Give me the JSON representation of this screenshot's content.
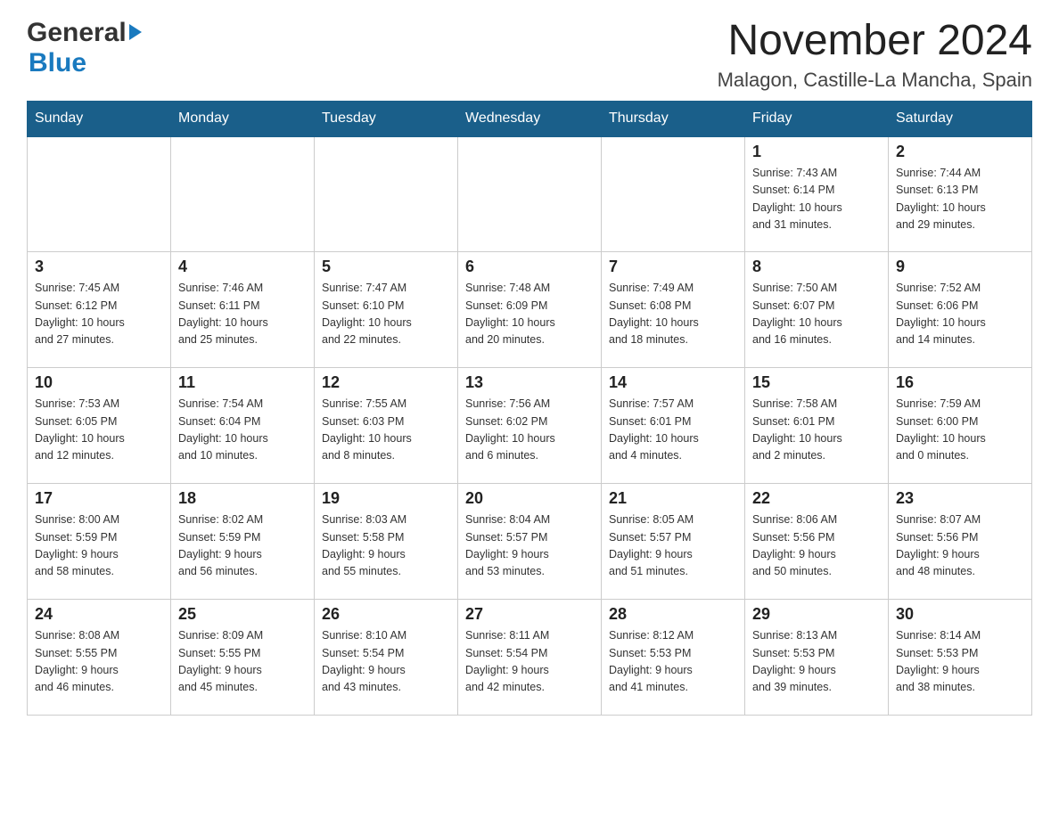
{
  "logo": {
    "general": "General",
    "blue": "Blue"
  },
  "title": {
    "month": "November 2024",
    "location": "Malagon, Castille-La Mancha, Spain"
  },
  "weekdays": [
    "Sunday",
    "Monday",
    "Tuesday",
    "Wednesday",
    "Thursday",
    "Friday",
    "Saturday"
  ],
  "weeks": [
    [
      {
        "day": "",
        "info": ""
      },
      {
        "day": "",
        "info": ""
      },
      {
        "day": "",
        "info": ""
      },
      {
        "day": "",
        "info": ""
      },
      {
        "day": "",
        "info": ""
      },
      {
        "day": "1",
        "info": "Sunrise: 7:43 AM\nSunset: 6:14 PM\nDaylight: 10 hours\nand 31 minutes."
      },
      {
        "day": "2",
        "info": "Sunrise: 7:44 AM\nSunset: 6:13 PM\nDaylight: 10 hours\nand 29 minutes."
      }
    ],
    [
      {
        "day": "3",
        "info": "Sunrise: 7:45 AM\nSunset: 6:12 PM\nDaylight: 10 hours\nand 27 minutes."
      },
      {
        "day": "4",
        "info": "Sunrise: 7:46 AM\nSunset: 6:11 PM\nDaylight: 10 hours\nand 25 minutes."
      },
      {
        "day": "5",
        "info": "Sunrise: 7:47 AM\nSunset: 6:10 PM\nDaylight: 10 hours\nand 22 minutes."
      },
      {
        "day": "6",
        "info": "Sunrise: 7:48 AM\nSunset: 6:09 PM\nDaylight: 10 hours\nand 20 minutes."
      },
      {
        "day": "7",
        "info": "Sunrise: 7:49 AM\nSunset: 6:08 PM\nDaylight: 10 hours\nand 18 minutes."
      },
      {
        "day": "8",
        "info": "Sunrise: 7:50 AM\nSunset: 6:07 PM\nDaylight: 10 hours\nand 16 minutes."
      },
      {
        "day": "9",
        "info": "Sunrise: 7:52 AM\nSunset: 6:06 PM\nDaylight: 10 hours\nand 14 minutes."
      }
    ],
    [
      {
        "day": "10",
        "info": "Sunrise: 7:53 AM\nSunset: 6:05 PM\nDaylight: 10 hours\nand 12 minutes."
      },
      {
        "day": "11",
        "info": "Sunrise: 7:54 AM\nSunset: 6:04 PM\nDaylight: 10 hours\nand 10 minutes."
      },
      {
        "day": "12",
        "info": "Sunrise: 7:55 AM\nSunset: 6:03 PM\nDaylight: 10 hours\nand 8 minutes."
      },
      {
        "day": "13",
        "info": "Sunrise: 7:56 AM\nSunset: 6:02 PM\nDaylight: 10 hours\nand 6 minutes."
      },
      {
        "day": "14",
        "info": "Sunrise: 7:57 AM\nSunset: 6:01 PM\nDaylight: 10 hours\nand 4 minutes."
      },
      {
        "day": "15",
        "info": "Sunrise: 7:58 AM\nSunset: 6:01 PM\nDaylight: 10 hours\nand 2 minutes."
      },
      {
        "day": "16",
        "info": "Sunrise: 7:59 AM\nSunset: 6:00 PM\nDaylight: 10 hours\nand 0 minutes."
      }
    ],
    [
      {
        "day": "17",
        "info": "Sunrise: 8:00 AM\nSunset: 5:59 PM\nDaylight: 9 hours\nand 58 minutes."
      },
      {
        "day": "18",
        "info": "Sunrise: 8:02 AM\nSunset: 5:59 PM\nDaylight: 9 hours\nand 56 minutes."
      },
      {
        "day": "19",
        "info": "Sunrise: 8:03 AM\nSunset: 5:58 PM\nDaylight: 9 hours\nand 55 minutes."
      },
      {
        "day": "20",
        "info": "Sunrise: 8:04 AM\nSunset: 5:57 PM\nDaylight: 9 hours\nand 53 minutes."
      },
      {
        "day": "21",
        "info": "Sunrise: 8:05 AM\nSunset: 5:57 PM\nDaylight: 9 hours\nand 51 minutes."
      },
      {
        "day": "22",
        "info": "Sunrise: 8:06 AM\nSunset: 5:56 PM\nDaylight: 9 hours\nand 50 minutes."
      },
      {
        "day": "23",
        "info": "Sunrise: 8:07 AM\nSunset: 5:56 PM\nDaylight: 9 hours\nand 48 minutes."
      }
    ],
    [
      {
        "day": "24",
        "info": "Sunrise: 8:08 AM\nSunset: 5:55 PM\nDaylight: 9 hours\nand 46 minutes."
      },
      {
        "day": "25",
        "info": "Sunrise: 8:09 AM\nSunset: 5:55 PM\nDaylight: 9 hours\nand 45 minutes."
      },
      {
        "day": "26",
        "info": "Sunrise: 8:10 AM\nSunset: 5:54 PM\nDaylight: 9 hours\nand 43 minutes."
      },
      {
        "day": "27",
        "info": "Sunrise: 8:11 AM\nSunset: 5:54 PM\nDaylight: 9 hours\nand 42 minutes."
      },
      {
        "day": "28",
        "info": "Sunrise: 8:12 AM\nSunset: 5:53 PM\nDaylight: 9 hours\nand 41 minutes."
      },
      {
        "day": "29",
        "info": "Sunrise: 8:13 AM\nSunset: 5:53 PM\nDaylight: 9 hours\nand 39 minutes."
      },
      {
        "day": "30",
        "info": "Sunrise: 8:14 AM\nSunset: 5:53 PM\nDaylight: 9 hours\nand 38 minutes."
      }
    ]
  ]
}
